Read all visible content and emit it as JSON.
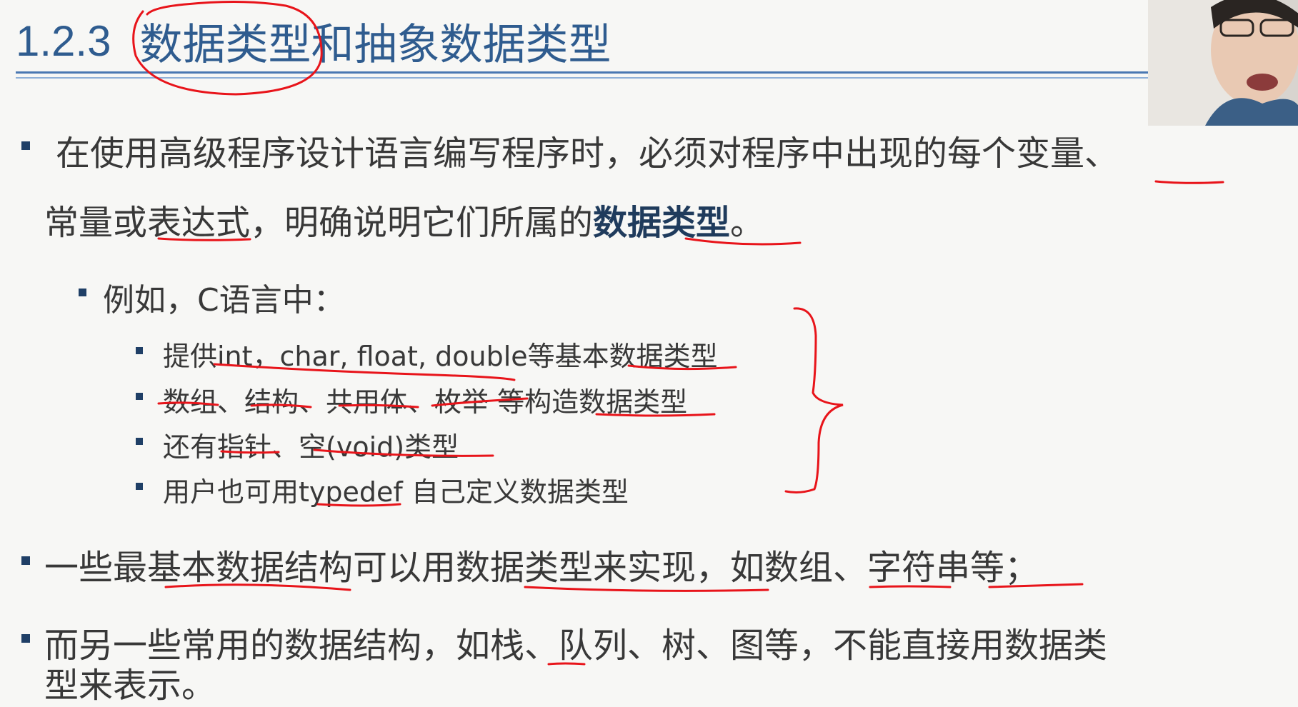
{
  "title": {
    "number": "1.2.3",
    "text": "数据类型和抽象数据类型"
  },
  "bullets": {
    "b1": {
      "line1": "在使用高级程序设计语言编写程序时，必须对程序中出现的每个变量、",
      "line2_a": "常量或表达式，明确说明它们所属的",
      "line2_bold": "数据类型",
      "line2_end": "。"
    },
    "b2": {
      "text": "例如，C语言中："
    },
    "b3": [
      "提供int，char, float, double等基本数据类型",
      "数组、结构、共用体、枚举 等构造数据类型",
      "还有指针、空(void)类型",
      "用户也可用typedef 自己定义数据类型"
    ],
    "b4": {
      "text": "一些最基本数据结构可以用数据类型来实现，如数组、字符串等；"
    },
    "b5": {
      "line1": "而另一些常用的数据结构，如栈、队列、树、图等，不能直接用数据类",
      "line2": "型来表示。"
    }
  },
  "colors": {
    "title": "#2f5c8f",
    "body_text": "#383838",
    "bullet": "#1f3f66",
    "annotation": "#e8141a"
  },
  "icons": {
    "webcam": "presenter-video-thumbnail"
  }
}
